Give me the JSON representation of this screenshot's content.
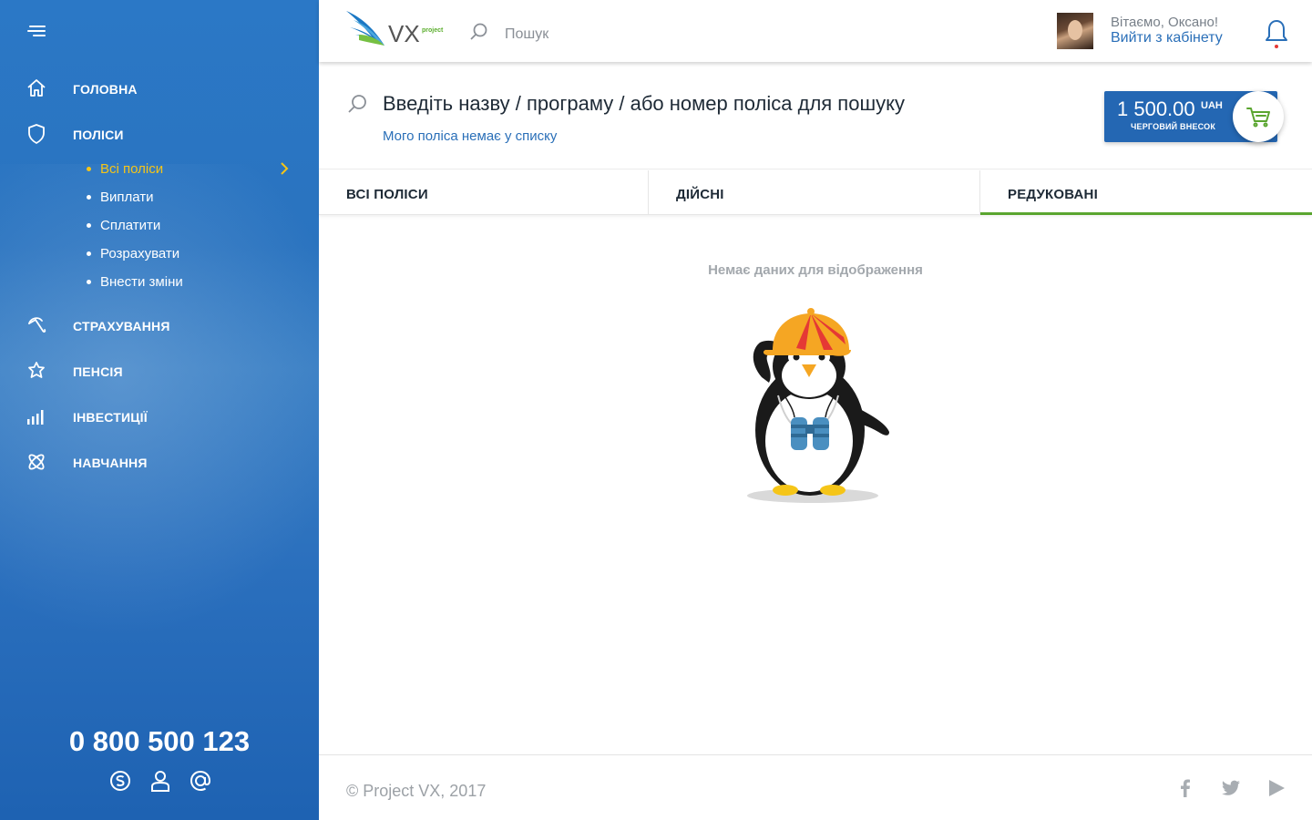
{
  "sidebar": {
    "menu_icon": "hamburger-icon",
    "items": [
      {
        "label": "ГОЛОВНА",
        "icon": "home-icon"
      },
      {
        "label": "ПОЛІСИ",
        "icon": "shield-icon"
      },
      {
        "label": "СТРАХУВАННЯ",
        "icon": "umbrella-icon"
      },
      {
        "label": "ПЕНСІЯ",
        "icon": "flower-icon"
      },
      {
        "label": "ІНВЕСТИЦІЇ",
        "icon": "bar-chart-icon"
      },
      {
        "label": "НАВЧАННЯ",
        "icon": "atom-icon"
      }
    ],
    "subitems": [
      {
        "label": "Всі поліси",
        "active": true
      },
      {
        "label": "Виплати"
      },
      {
        "label": "Сплатити"
      },
      {
        "label": "Розрахувати"
      },
      {
        "label": "Внести зміни"
      }
    ],
    "active_color": "#f5c518",
    "phone": "0 800 500 123",
    "contact_icons": [
      "skype-icon",
      "user-icon",
      "at-icon"
    ]
  },
  "header": {
    "logo_text": "VX",
    "logo_sub": "project",
    "search_placeholder": "Пошук",
    "greeting": "Вітаємо, Оксано!",
    "logout": "Вийти з кабінету",
    "notification_icon": "bell-icon"
  },
  "search_block": {
    "prompt": "Введіть назву / програму / або номер поліса для пошуку",
    "not_listed_link": "Мого поліса немає у списку",
    "payment": {
      "amount": "1 500.00",
      "currency": "UAH",
      "label": "ЧЕРГОВИЙ ВНЕСОК"
    },
    "cart_icon": "cart-icon"
  },
  "tabs": [
    {
      "label": "ВСІ ПОЛІСИ"
    },
    {
      "label": "ДІЙСНІ"
    },
    {
      "label": "РЕДУКОВАНІ",
      "active": true
    }
  ],
  "empty_state": {
    "message": "Немає даних для відображення",
    "illustration": "penguin-with-binoculars"
  },
  "footer": {
    "copyright": "© Project VX, 2017",
    "social_icons": [
      "facebook-icon",
      "twitter-icon",
      "youtube-icon"
    ]
  },
  "colors": {
    "sidebar_blue": "#2a73bf",
    "accent_green": "#5aa52f",
    "link_blue": "#2a6fb8",
    "payment_blue": "#2467b3"
  }
}
